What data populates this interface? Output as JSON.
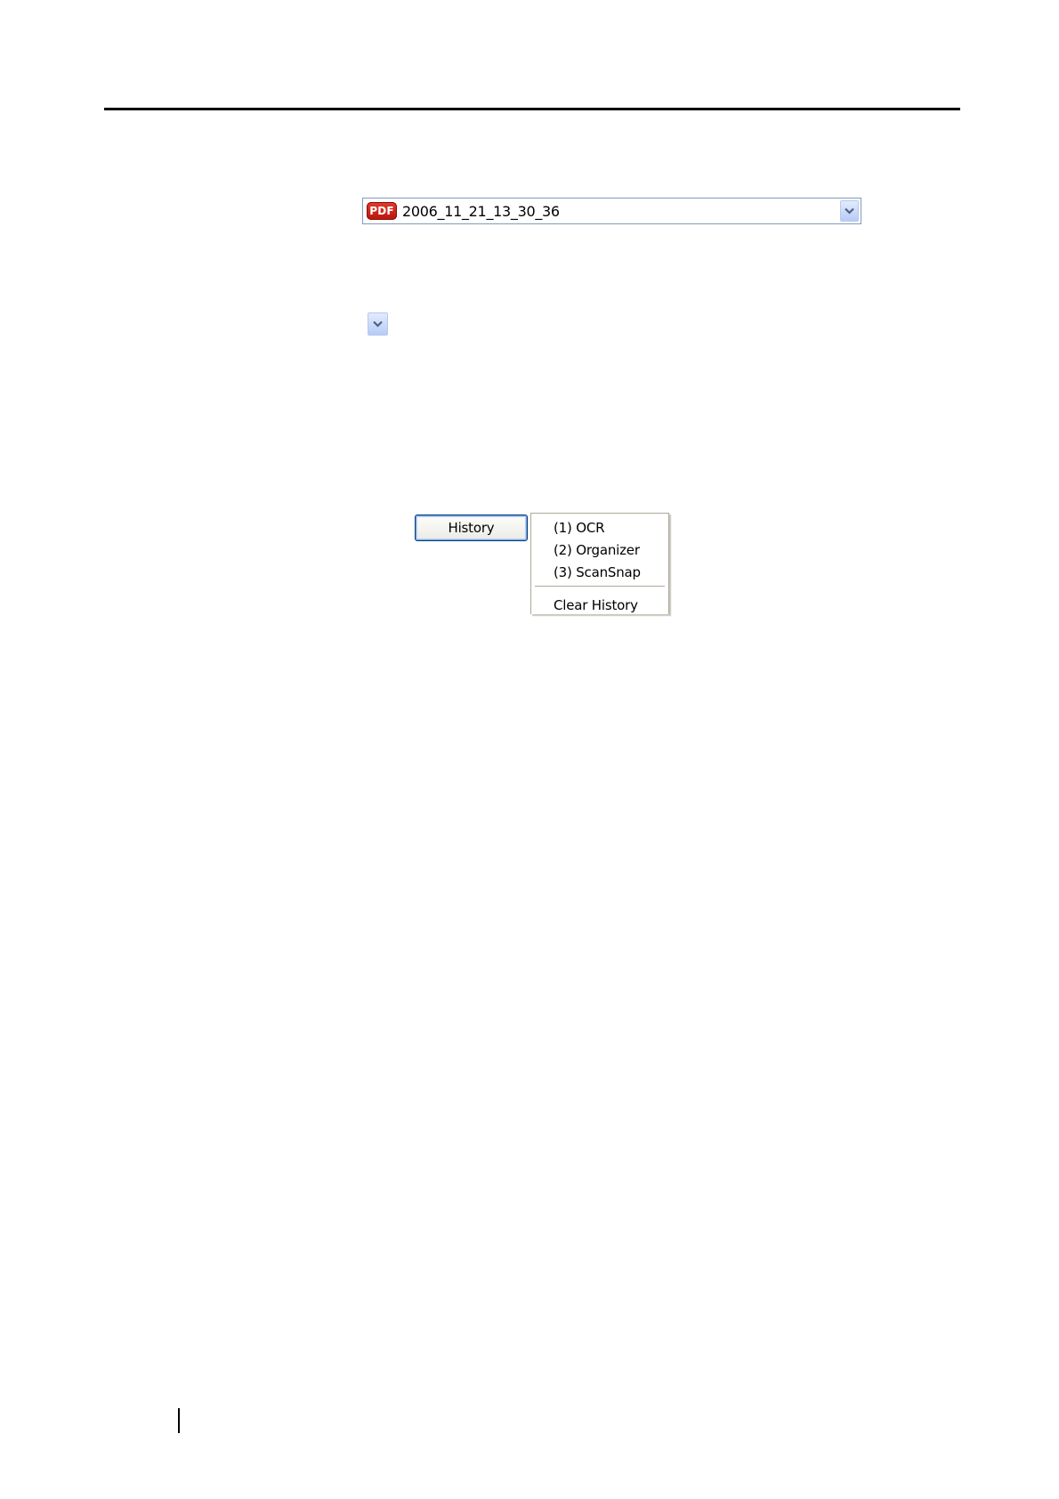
{
  "file_selector": {
    "file_type_icon": "pdf-icon",
    "file_type_label": "PDF",
    "selected_file": "2006_11_21_13_30_36",
    "arrow_icon": "chevron-down-icon",
    "accent_color": "#7f9db9",
    "pdf_icon_color": "#d2271c"
  },
  "dropdown_button": {
    "arrow_icon": "chevron-down-icon"
  },
  "history": {
    "button_label": "History",
    "menu_items": [
      {
        "label": "(1) OCR"
      },
      {
        "label": "(2) Organizer"
      },
      {
        "label": "(3) ScanSnap"
      }
    ],
    "clear_label": "Clear History"
  }
}
